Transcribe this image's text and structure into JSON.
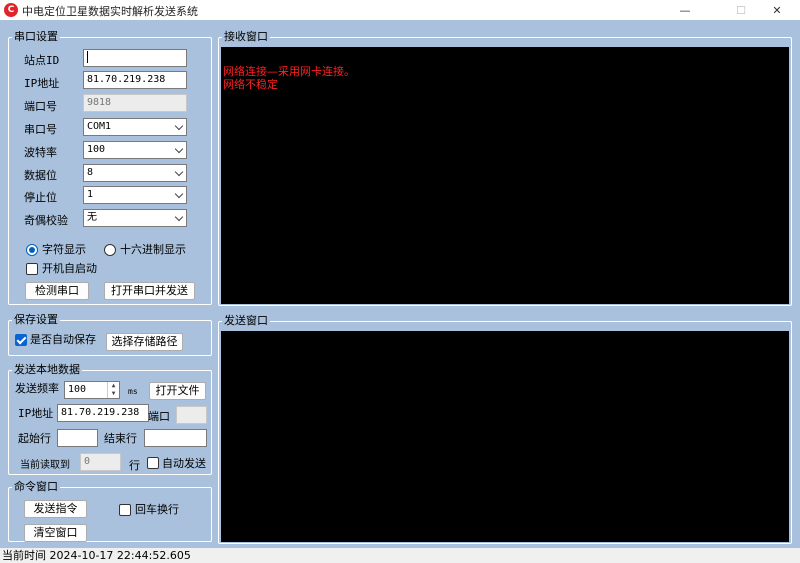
{
  "window": {
    "title": "中电定位卫星数据实时解析发送系统",
    "icon_letter": "C",
    "minimize": "—",
    "maximize": "☐",
    "close": "✕"
  },
  "serial": {
    "group_title": "串口设置",
    "station_id_label": "站点ID",
    "station_id_value": "",
    "ip_label": "IP地址",
    "ip_value": "81.70.219.238",
    "port_label": "端口号",
    "port_value": "9818",
    "com_label": "串口号",
    "com_value": "COM1",
    "baud_label": "波特率",
    "baud_value": "100",
    "databits_label": "数据位",
    "databits_value": "8",
    "stopbits_label": "停止位",
    "stopbits_value": "1",
    "parity_label": "奇偶校验",
    "parity_value": "无",
    "radio_char": "字符显示",
    "radio_hex": "十六进制显示",
    "autostart_label": "开机自启动",
    "detect_button": "检测串口",
    "open_send_button": "打开串口并发送"
  },
  "save": {
    "group_title": "保存设置",
    "autosave_label": "是否自动保存",
    "choose_path_button": "选择存储路径"
  },
  "local": {
    "group_title": "发送本地数据",
    "freq_label": "发送频率",
    "freq_value": "100",
    "freq_unit": "ms",
    "open_file_button": "打开文件",
    "ip_label": "IP地址",
    "ip_value": "81.70.219.238",
    "port_label": "端口",
    "port_value": "",
    "start_label": "起始行",
    "start_value": "",
    "end_label": "结束行",
    "end_value": "",
    "current_label": "当前读取到",
    "current_value": "0",
    "row_unit": "行",
    "autosend_label": "自动发送"
  },
  "command": {
    "group_title": "命令窗口",
    "send_button": "发送指令",
    "crlf_label": "回车换行",
    "clear_button": "清空窗口"
  },
  "receive": {
    "group_title": "接收窗口",
    "lines": [
      "网络连接—采用网卡连接。",
      "网络不稳定"
    ],
    "text_color": "#ff2020"
  },
  "send": {
    "group_title": "发送窗口"
  },
  "status": {
    "text": "当前时间 2024-10-17 22:44:52.605"
  }
}
